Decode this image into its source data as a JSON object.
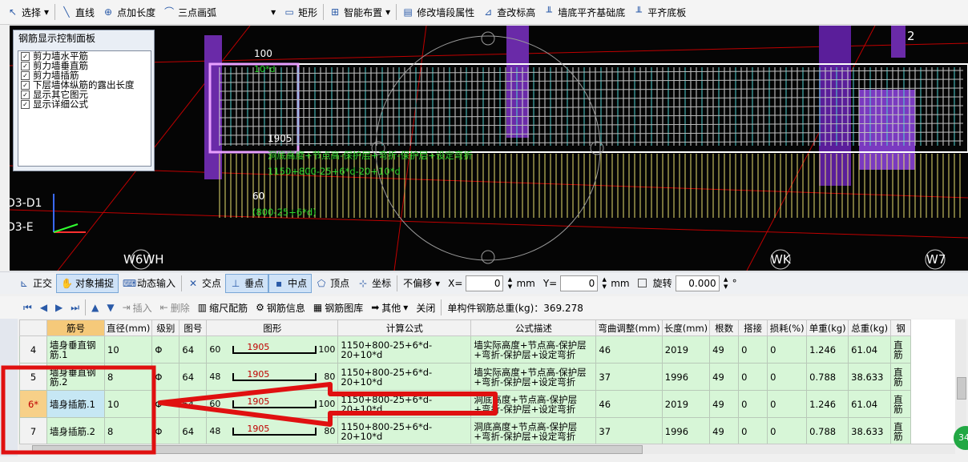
{
  "toolbar": {
    "items": [
      "选择",
      "直线",
      "点加长度",
      "三点画弧",
      "矩形",
      "智能布置",
      "修改墙段属性",
      "查改标高",
      "墙底平齐基础底",
      "平齐底板"
    ]
  },
  "canvas": {
    "panel_title": "钢筋显示控制面板",
    "options": [
      "剪力墙水平筋",
      "剪力墙垂直筋",
      "剪力墙插筋",
      "下层墙体纵筋的露出长度",
      "显示其它图元",
      "显示详细公式"
    ],
    "labels": {
      "dim_100": "100",
      "formula_small": "10*d",
      "dim_1905": "1905",
      "desc_line": "洞底高度+节点高-保护层+弯折-保护层+设定弯折",
      "formula_line": "1150+800-25+6*d-20+10*d",
      "dim_60": "60",
      "formula_60": "(800-25+6*d)",
      "axis_d1": "D3-D1",
      "axis_e": "D3-E",
      "axis_w6wh": "W6WH",
      "axis_wk": "WK",
      "axis_w7": "W7",
      "axis_2": "2"
    }
  },
  "snapbar": {
    "items": [
      "正交",
      "对象捕捉",
      "动态输入",
      "交点",
      "垂点",
      "中点",
      "顶点",
      "坐标"
    ],
    "mode": "不偏移",
    "x_label": "X=",
    "x_value": "0",
    "unit": "mm",
    "y_label": "Y=",
    "y_value": "0",
    "rotate_label": "旋转",
    "rotate_value": "0.000",
    "degree": "°"
  },
  "table_toolbar": {
    "insert": "插入",
    "delete": "删除",
    "scale": "缩尺配筋",
    "info": "钢筋信息",
    "library": "钢筋图库",
    "other": "其他",
    "close": "关闭",
    "total": "单构件钢筋总重(kg)：369.278"
  },
  "table": {
    "headers": [
      "筋号",
      "直径(mm)",
      "级别",
      "图号",
      "图形",
      "计算公式",
      "公式描述",
      "弯曲调整(mm)",
      "长度(mm)",
      "根数",
      "搭接",
      "损耗(%)",
      "单重(kg)",
      "总重(kg)",
      "钢"
    ],
    "rows": [
      {
        "num": "4",
        "name": "墙身垂直钢筋.1",
        "dia": "10",
        "grade": "Φ",
        "fig": "64",
        "left": "60",
        "mid": "1905",
        "right": "100",
        "formula": "1150+800-25+6*d-20+10*d",
        "desc": "墙实际高度+节点高-保护层+弯折-保护层+设定弯折",
        "bend": "46",
        "len": "2019",
        "count": "49",
        "lap": "0",
        "loss": "0",
        "unit_w": "1.246",
        "total_w": "61.04",
        "type": "直筋"
      },
      {
        "num": "5",
        "name": "墙身垂直钢筋.2",
        "dia": "8",
        "grade": "Φ",
        "fig": "64",
        "left": "48",
        "mid": "1905",
        "right": "80",
        "formula": "1150+800-25+6*d-20+10*d",
        "desc": "墙实际高度+节点高-保护层+弯折-保护层+设定弯折",
        "bend": "37",
        "len": "1996",
        "count": "49",
        "lap": "0",
        "loss": "0",
        "unit_w": "0.788",
        "total_w": "38.633",
        "type": "直筋"
      },
      {
        "num": "6*",
        "name": "墙身插筋.1",
        "dia": "10",
        "grade": "Φ",
        "fig": "64",
        "left": "60",
        "mid": "1905",
        "right": "100",
        "formula": "1150+800-25+6*d-20+10*d",
        "desc": "洞底高度+节点高-保护层+弯折-保护层+设定弯折",
        "bend": "46",
        "len": "2019",
        "count": "49",
        "lap": "0",
        "loss": "0",
        "unit_w": "1.246",
        "total_w": "61.04",
        "type": "直筋"
      },
      {
        "num": "7",
        "name": "墙身插筋.2",
        "dia": "8",
        "grade": "Φ",
        "fig": "64",
        "left": "48",
        "mid": "1905",
        "right": "80",
        "formula": "1150+800-25+6*d-20+10*d",
        "desc": "洞底高度+节点高-保护层+弯折-保护层+设定弯折",
        "bend": "37",
        "len": "1996",
        "count": "49",
        "lap": "0",
        "loss": "0",
        "unit_w": "0.788",
        "total_w": "38.633",
        "type": "直筋"
      }
    ]
  },
  "badge": "34"
}
